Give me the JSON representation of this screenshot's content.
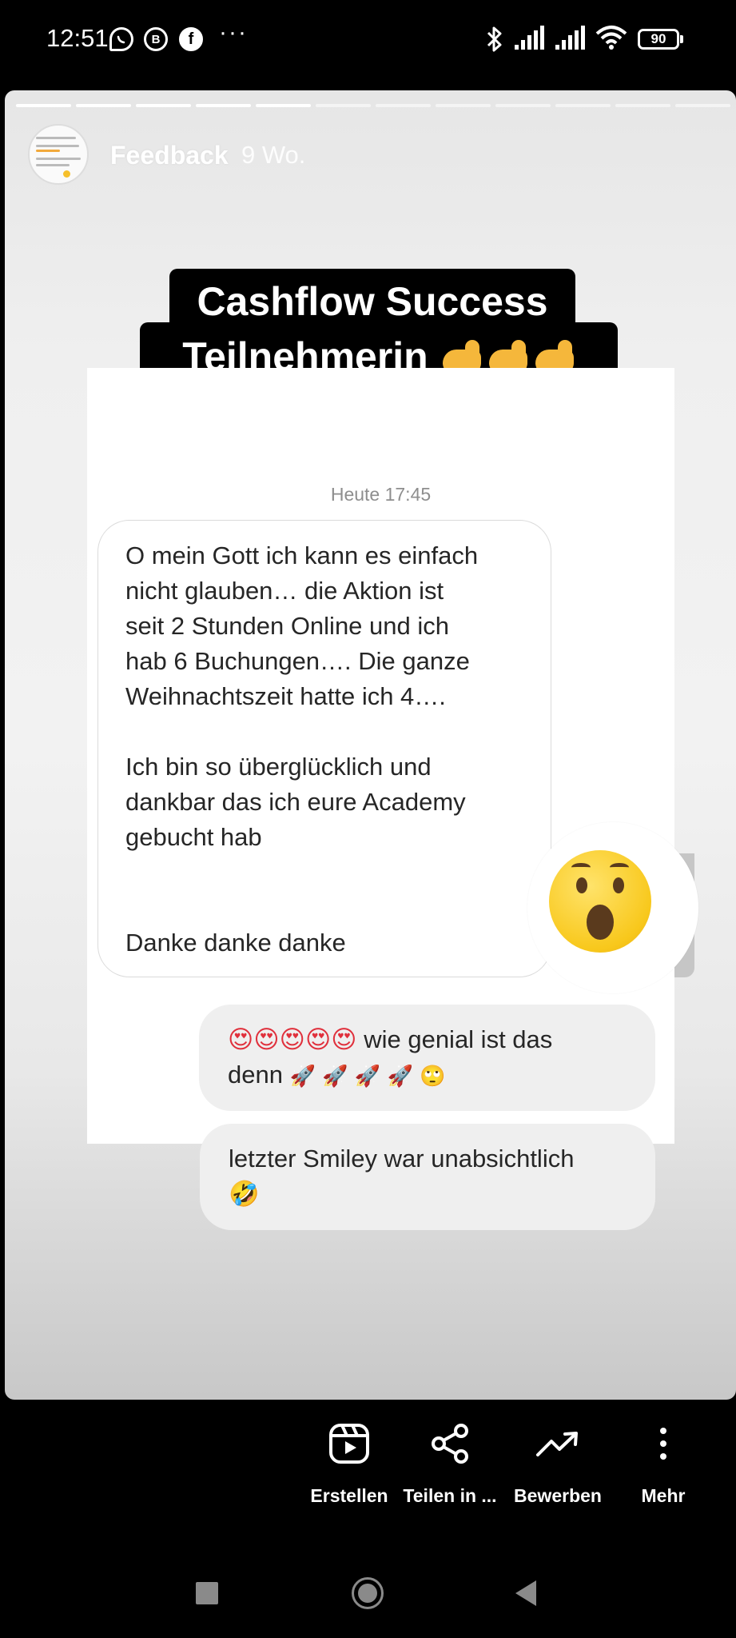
{
  "status_bar": {
    "time": "12:51",
    "app_icons": [
      "whatsapp-icon",
      "b-icon",
      "facebook-icon"
    ],
    "b_letter": "B",
    "facebook_letter": "f",
    "more": "···",
    "battery": "90"
  },
  "story": {
    "progress_total": 12,
    "progress_done": 5,
    "user": "Feedback",
    "age": "9 Wo."
  },
  "headline": {
    "line1": "Cashflow Success",
    "line2": "Teilnehmerin"
  },
  "chat": {
    "time": "Heute 17:45",
    "incoming": {
      "p1": [
        "O mein Gott ich kann es einfach",
        "nicht glauben… die Aktion ist",
        "seit 2 Stunden Online und ich",
        "hab 6 Buchungen…. Die ganze",
        "Weihnachtszeit hatte ich 4…."
      ],
      "p2": [
        "Ich bin so überglücklich und",
        "dankbar das ich eure Academy",
        "gebucht hab"
      ],
      "p3": "Danke danke danke"
    },
    "outgoing": [
      {
        "line1_emoji": "😍😍😍😍😍",
        "line1_text": " wie genial ist das",
        "line2_text": "denn ",
        "line2_emoji": "🚀 🚀 🚀 🚀 🙄"
      },
      {
        "line1_text": "letzter Smiley war unabsichtlich",
        "line2_emoji": "🤣"
      }
    ],
    "reaction": "hushed-face-emoji"
  },
  "actions": [
    {
      "label": "Erstellen",
      "icon": "reels-icon"
    },
    {
      "label": "Teilen in ...",
      "icon": "share-icon"
    },
    {
      "label": "Bewerben",
      "icon": "trending-up-icon"
    },
    {
      "label": "Mehr",
      "icon": "more-vertical-icon"
    }
  ],
  "nav": [
    "recents-button",
    "home-button",
    "back-button"
  ]
}
